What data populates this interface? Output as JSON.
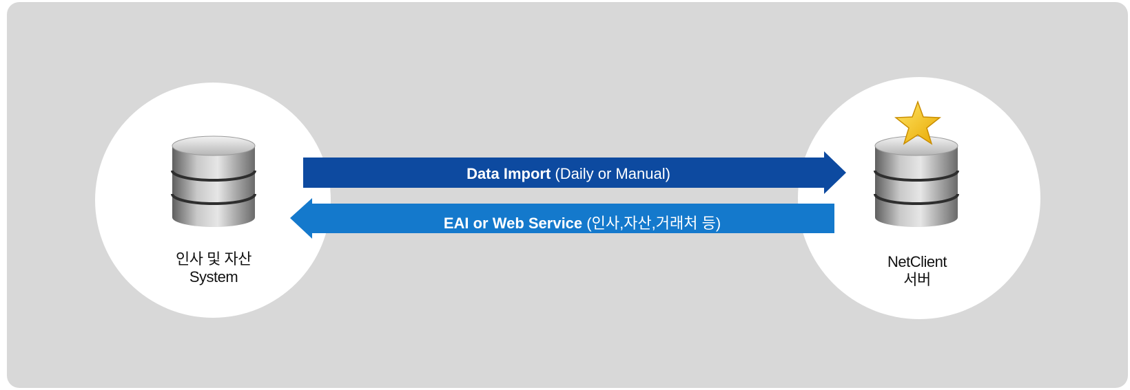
{
  "left_node": {
    "icon": "database-icon",
    "label_line1": "인사 및 자산",
    "label_line2": "System"
  },
  "right_node": {
    "icon": "database-icon",
    "badge_icon": "star-icon",
    "label_line1": "NetClient",
    "label_line2": "서버"
  },
  "arrows": {
    "import": {
      "direction": "right",
      "bold": "Data Import",
      "rest": " (Daily or Manual)",
      "color": "#0d4aa0"
    },
    "service": {
      "direction": "left",
      "bold": "EAI or Web Service",
      "rest": " (인사,자산,거래처 등)",
      "color": "#1479cc"
    }
  },
  "colors": {
    "background_panel": "#d8d8d8",
    "node_circle": "#ffffff",
    "star": "#f5c518"
  }
}
